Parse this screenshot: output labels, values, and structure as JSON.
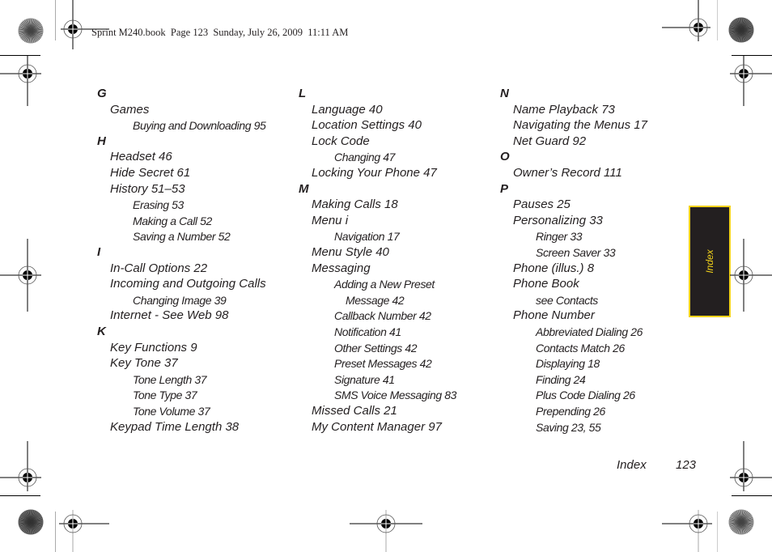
{
  "slug_line": "Sprint M240.book  Page 123  Sunday, July 26, 2009  11:11 AM",
  "columns": [
    {
      "rows": [
        {
          "level": 0,
          "text": "G"
        },
        {
          "level": 1,
          "text": "Games"
        },
        {
          "level": 2,
          "text": "Buying and Downloading 95"
        },
        {
          "level": 0,
          "text": "H"
        },
        {
          "level": 1,
          "text": "Headset 46"
        },
        {
          "level": 1,
          "text": "Hide Secret 61"
        },
        {
          "level": 1,
          "text": "History 51–53"
        },
        {
          "level": 2,
          "text": "Erasing 53"
        },
        {
          "level": 2,
          "text": "Making a Call 52"
        },
        {
          "level": 2,
          "text": "Saving a Number 52"
        },
        {
          "level": 0,
          "text": "I"
        },
        {
          "level": 1,
          "text": "In-Call Options 22"
        },
        {
          "level": 1,
          "text": "Incoming and Outgoing Calls"
        },
        {
          "level": 2,
          "text": "Changing Image 39"
        },
        {
          "level": 1,
          "text": "Internet - See Web 98"
        },
        {
          "level": 0,
          "text": "K"
        },
        {
          "level": 1,
          "text": "Key Functions 9"
        },
        {
          "level": 1,
          "text": "Key Tone 37"
        },
        {
          "level": 2,
          "text": "Tone Length 37"
        },
        {
          "level": 2,
          "text": "Tone Type 37"
        },
        {
          "level": 2,
          "text": "Tone Volume 37"
        },
        {
          "level": 1,
          "text": "Keypad Time Length 38"
        }
      ]
    },
    {
      "rows": [
        {
          "level": 0,
          "text": "L"
        },
        {
          "level": 1,
          "text": "Language 40"
        },
        {
          "level": 1,
          "text": "Location Settings 40"
        },
        {
          "level": 1,
          "text": "Lock Code"
        },
        {
          "level": 2,
          "text": "Changing 47"
        },
        {
          "level": 1,
          "text": "Locking Your Phone 47"
        },
        {
          "level": 0,
          "text": "M"
        },
        {
          "level": 1,
          "text": "Making Calls 18"
        },
        {
          "level": 1,
          "text": "Menu i"
        },
        {
          "level": 2,
          "text": "Navigation 17"
        },
        {
          "level": 1,
          "text": "Menu Style 40"
        },
        {
          "level": 1,
          "text": "Messaging"
        },
        {
          "level": 2,
          "text": "Adding a New Preset"
        },
        {
          "level": 3,
          "text": "Message 42"
        },
        {
          "level": 2,
          "text": "Callback Number 42"
        },
        {
          "level": 2,
          "text": "Notification 41"
        },
        {
          "level": 2,
          "text": "Other Settings 42"
        },
        {
          "level": 2,
          "text": "Preset Messages 42"
        },
        {
          "level": 2,
          "text": "Signature 41"
        },
        {
          "level": 2,
          "text": "SMS Voice Messaging 83"
        },
        {
          "level": 1,
          "text": "Missed Calls 21"
        },
        {
          "level": 1,
          "text": "My Content Manager 97"
        }
      ]
    },
    {
      "rows": [
        {
          "level": 0,
          "text": "N"
        },
        {
          "level": 1,
          "text": "Name Playback 73"
        },
        {
          "level": 1,
          "text": "Navigating the Menus 17"
        },
        {
          "level": 1,
          "text": "Net Guard 92"
        },
        {
          "level": 0,
          "text": "O"
        },
        {
          "level": 1,
          "text": "Owner’s Record 111"
        },
        {
          "level": 0,
          "text": "P"
        },
        {
          "level": 1,
          "text": "Pauses 25"
        },
        {
          "level": 1,
          "text": "Personalizing 33"
        },
        {
          "level": 2,
          "text": "Ringer 33"
        },
        {
          "level": 2,
          "text": "Screen Saver 33"
        },
        {
          "level": 1,
          "text": "Phone (illus.) 8"
        },
        {
          "level": 1,
          "text": "Phone Book"
        },
        {
          "level": 2,
          "text": "see Contacts"
        },
        {
          "level": 1,
          "text": "Phone Number"
        },
        {
          "level": 2,
          "text": "Abbreviated Dialing 26"
        },
        {
          "level": 2,
          "text": "Contacts Match 26"
        },
        {
          "level": 2,
          "text": "Displaying 18"
        },
        {
          "level": 2,
          "text": "Finding 24"
        },
        {
          "level": 2,
          "text": "Plus Code Dialing 26"
        },
        {
          "level": 2,
          "text": "Prepending 26"
        },
        {
          "level": 2,
          "text": "Saving 23, 55"
        }
      ]
    }
  ],
  "side_tab": {
    "label": "Index",
    "background": "#231f20",
    "accent": "#f2d21b"
  },
  "footer": {
    "section": "Index",
    "page_number": "123"
  },
  "icons": {
    "registration_mark": "crosshair-registration-icon",
    "color_bar": "starburst-target-icon"
  }
}
